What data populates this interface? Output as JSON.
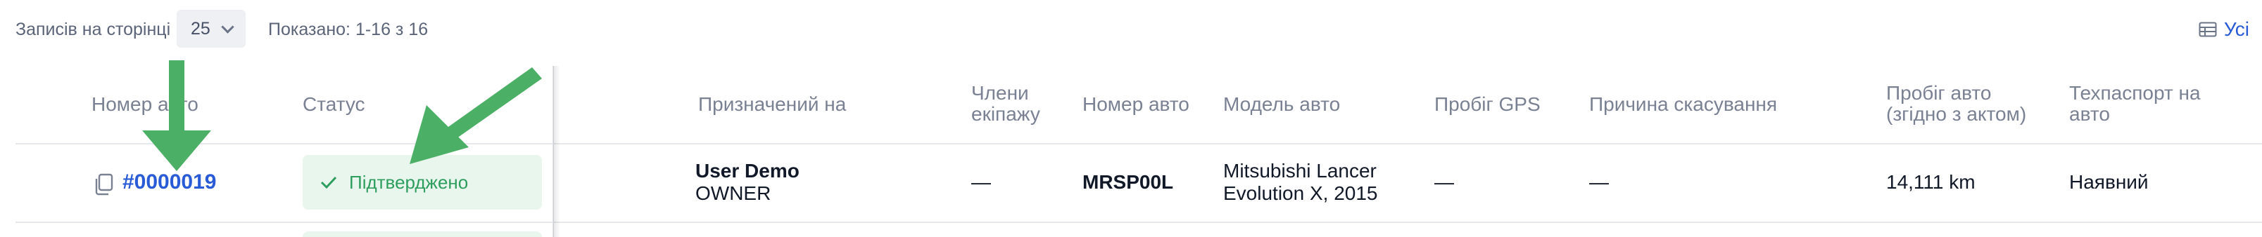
{
  "toolbar": {
    "per_page_label": "Записів на сторінці",
    "per_page_value": "25",
    "shown": "Показано: 1-16 з 16",
    "all_button": "Усі"
  },
  "table": {
    "headers": {
      "vehicle_number": "Номер авто",
      "status": "Статус",
      "assigned_to": "Призначений на",
      "crew_members": "Члени екіпажу",
      "car_number": "Номер авто",
      "car_model": "Модель авто",
      "gps_mileage": "Пробіг GPS",
      "cancel_reason": "Причина скасування",
      "mileage_act": "Пробіг авто (згідно з актом)",
      "tech_passport": "Техпаспорт на авто"
    },
    "rows": [
      {
        "order_id": "#0000019",
        "status": "Підтверджено",
        "assignee_name": "User Demo",
        "assignee_role": "OWNER",
        "crew": "—",
        "plate": "MRSP00L",
        "model": "Mitsubishi Lancer Evolution X, 2015",
        "gps": "—",
        "cancel_reason": "—",
        "mileage": "14,111 km",
        "tech_passport": "Наявний"
      }
    ]
  },
  "colors": {
    "link": "#2a5bd7",
    "status_bg": "#e9f6ee",
    "status_text": "#2e9e5e",
    "annotation_arrow": "#4caf66"
  },
  "icons": [
    "chevron-down-icon",
    "table-icon",
    "copy-icon",
    "check-icon",
    "annotation-arrow-icon"
  ]
}
